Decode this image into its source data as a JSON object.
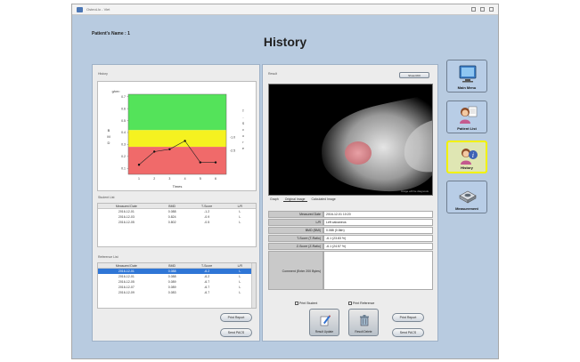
{
  "window": {
    "title": "OsteoLlo - Viet"
  },
  "header": {
    "patient_label": "Patient's Name : 1",
    "title": "History"
  },
  "left_panel": {
    "history_label": "History",
    "chart_data": {
      "type": "line",
      "y_unit": "g/cm²",
      "ylabel_left": "BMD",
      "ylabel_right_a": "T-Score",
      "ylabel_right_b": "Z-Score",
      "xlabel": "Times",
      "categories": [
        "1",
        "2",
        "3",
        "4",
        "5",
        "6"
      ],
      "yticks": [
        "0.1",
        "0.2",
        "0.3",
        "0.4",
        "0.5",
        "0.6",
        "0.7"
      ],
      "right_ticks": [
        "-1.0",
        "-2.5"
      ],
      "ylim": [
        0.05,
        0.72
      ],
      "zones": [
        {
          "name": "normal",
          "from": 0.42,
          "to": 0.72,
          "color": "#54e35a"
        },
        {
          "name": "osteopenia",
          "from": 0.28,
          "to": 0.42,
          "color": "#f5f220"
        },
        {
          "name": "osteoporosis",
          "from": 0.05,
          "to": 0.28,
          "color": "#f06a6a"
        }
      ],
      "series": [
        {
          "values": [
            0.13,
            0.24,
            0.26,
            0.33,
            0.15,
            0.15
          ]
        }
      ]
    },
    "student_list": {
      "label": "Student List",
      "headers": [
        "Measured Date",
        "BMD",
        "T-Score",
        "L/R"
      ],
      "rows": [
        [
          "2016-12-01",
          "0.088",
          "-1.2",
          "L"
        ],
        [
          "2016-12-03",
          "0.824",
          "-0.9",
          "L"
        ],
        [
          "2016-12-05",
          "0.802",
          "-0.5",
          "L"
        ]
      ]
    },
    "reference_list": {
      "label": "Reference List",
      "headers": [
        "Measured Date",
        "BMD",
        "T-Score",
        "L/R"
      ],
      "rows": [
        [
          "2016-12-01",
          "0.088",
          "-6.2",
          "L"
        ],
        [
          "2016-12-01",
          "0.088",
          "-6.2",
          "L"
        ],
        [
          "2016-12-05",
          "0.089",
          "-6.7",
          "L"
        ],
        [
          "2016-12-07",
          "0.089",
          "-6.7",
          "L"
        ],
        [
          "2016-12-09",
          "0.083",
          "-6.7",
          "L"
        ]
      ]
    },
    "btn_print_top": "Print Report",
    "btn_send_top": "Send PACS",
    "btn_print_bottom": "Print Report",
    "btn_send_bottom": "Send PACS"
  },
  "right_panel": {
    "result_label": "Result",
    "small_btn": "Show ROI",
    "image_caption": "Image will be diagnosis",
    "tabs": [
      "Graph",
      "Original Image",
      "Calculated Image"
    ],
    "info": [
      {
        "key": "Measured Date",
        "value": "2016-12-01 10:20"
      },
      {
        "key": "L/R",
        "value": "Left calcaneus"
      },
      {
        "key": "BMD (BMI)",
        "value": "0.088 (0.8kh)"
      },
      {
        "key": "T-Score (T-Ratio)",
        "value": "-6.1 (23.83 %)"
      },
      {
        "key": "Z-Score (Z-Ratio)",
        "value": "-6.1 (24.57 %)"
      }
    ],
    "comment_label": "Comment (Enter 200 Bytes)",
    "comment_value": "",
    "chk_print_student": "Print Student",
    "chk_print_reference": "Print Reference",
    "btn_result_update": "Result Update",
    "btn_result_delete": "Result Delete",
    "btn_print_report": "Print Report",
    "btn_send_pacs": "Send PACS"
  },
  "nav": [
    {
      "label": "Main Menu"
    },
    {
      "label": "Patient List"
    },
    {
      "label": "History"
    },
    {
      "label": "Measurement"
    }
  ]
}
